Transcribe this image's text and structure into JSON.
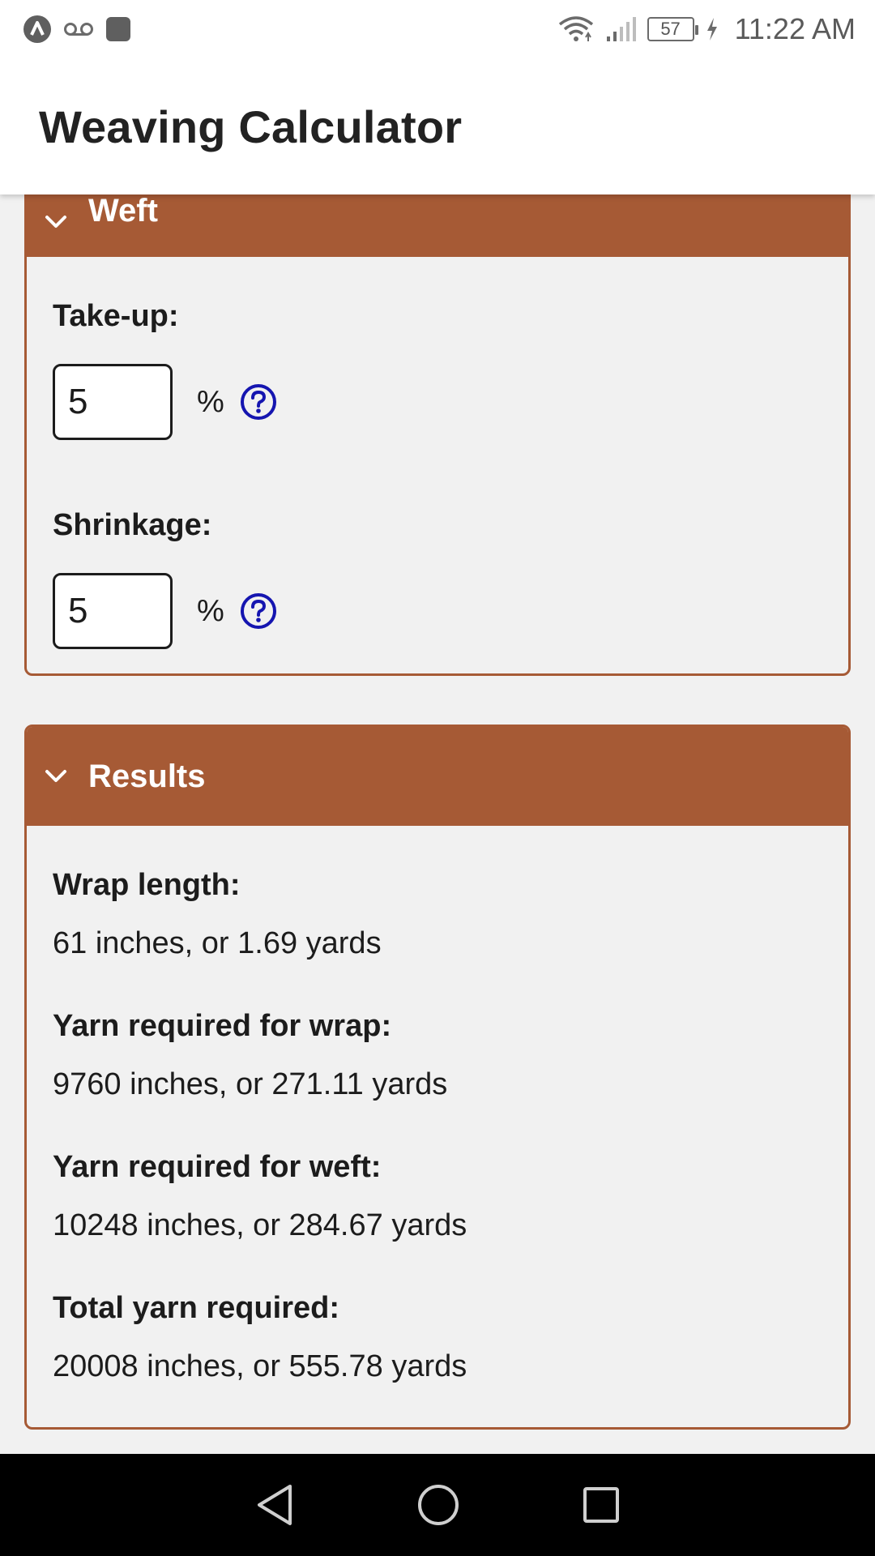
{
  "status_bar": {
    "time": "11:22 AM",
    "battery": "57",
    "left_icons": [
      "app-notification-icon",
      "voicemail-icon",
      "square-notification-icon"
    ],
    "right_icons": [
      "wifi-icon",
      "signal-icon",
      "battery-icon",
      "charging-icon"
    ]
  },
  "app_bar": {
    "title": "Weaving Calculator"
  },
  "weft": {
    "header": "Weft",
    "takeup_label": "Take-up:",
    "takeup_value": "5",
    "takeup_unit": "%",
    "shrinkage_label": "Shrinkage:",
    "shrinkage_value": "5",
    "shrinkage_unit": "%"
  },
  "results": {
    "header": "Results",
    "items": [
      {
        "label": "Wrap length:",
        "value": "61 inches, or 1.69 yards"
      },
      {
        "label": "Yarn required for wrap:",
        "value": "9760 inches, or 271.11 yards"
      },
      {
        "label": "Yarn required for weft:",
        "value": "10248 inches, or 284.67 yards"
      },
      {
        "label": "Total yarn required:",
        "value": "20008 inches, or 555.78 yards"
      }
    ]
  },
  "colors": {
    "accent": "#a65a35",
    "help_icon": "#1515b0",
    "nav_background": "#000000"
  }
}
